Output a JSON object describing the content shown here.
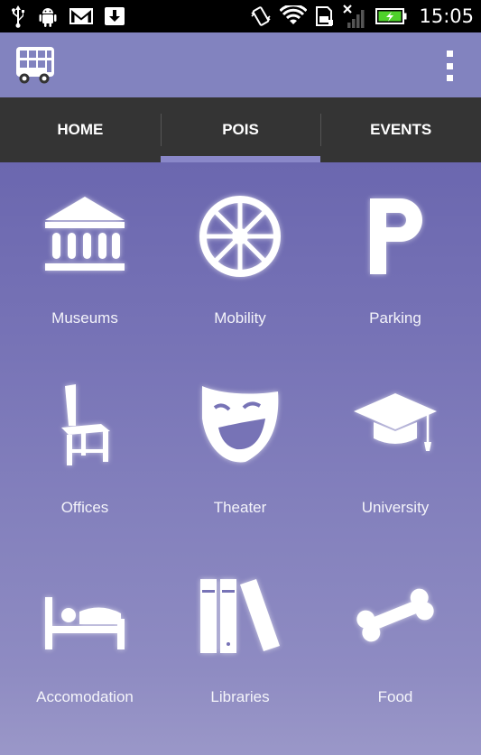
{
  "status_bar": {
    "time": "15:05",
    "icons": [
      "usb-icon",
      "android-debug-icon",
      "gmail-icon",
      "download-icon",
      "vibrate-icon",
      "wifi-icon",
      "sd-card-icon",
      "signal-off-icon",
      "battery-charging-icon"
    ]
  },
  "action_bar": {
    "logo_icon": "bus-icon",
    "menu_icon": "overflow-menu-icon",
    "color": "#8283bf"
  },
  "tabs": [
    {
      "label": "HOME"
    },
    {
      "label": "POIS",
      "active": true
    },
    {
      "label": "EVENTS"
    }
  ],
  "categories": [
    {
      "label": "Museums",
      "icon": "museum-icon"
    },
    {
      "label": "Mobility",
      "icon": "wheel-icon"
    },
    {
      "label": "Parking",
      "icon": "parking-icon"
    },
    {
      "label": "Offices",
      "icon": "chair-icon"
    },
    {
      "label": "Theater",
      "icon": "theater-mask-icon"
    },
    {
      "label": "University",
      "icon": "graduation-cap-icon"
    },
    {
      "label": "Accomodation",
      "icon": "bed-icon"
    },
    {
      "label": "Libraries",
      "icon": "books-icon"
    },
    {
      "label": "Food",
      "icon": "bone-icon"
    }
  ]
}
